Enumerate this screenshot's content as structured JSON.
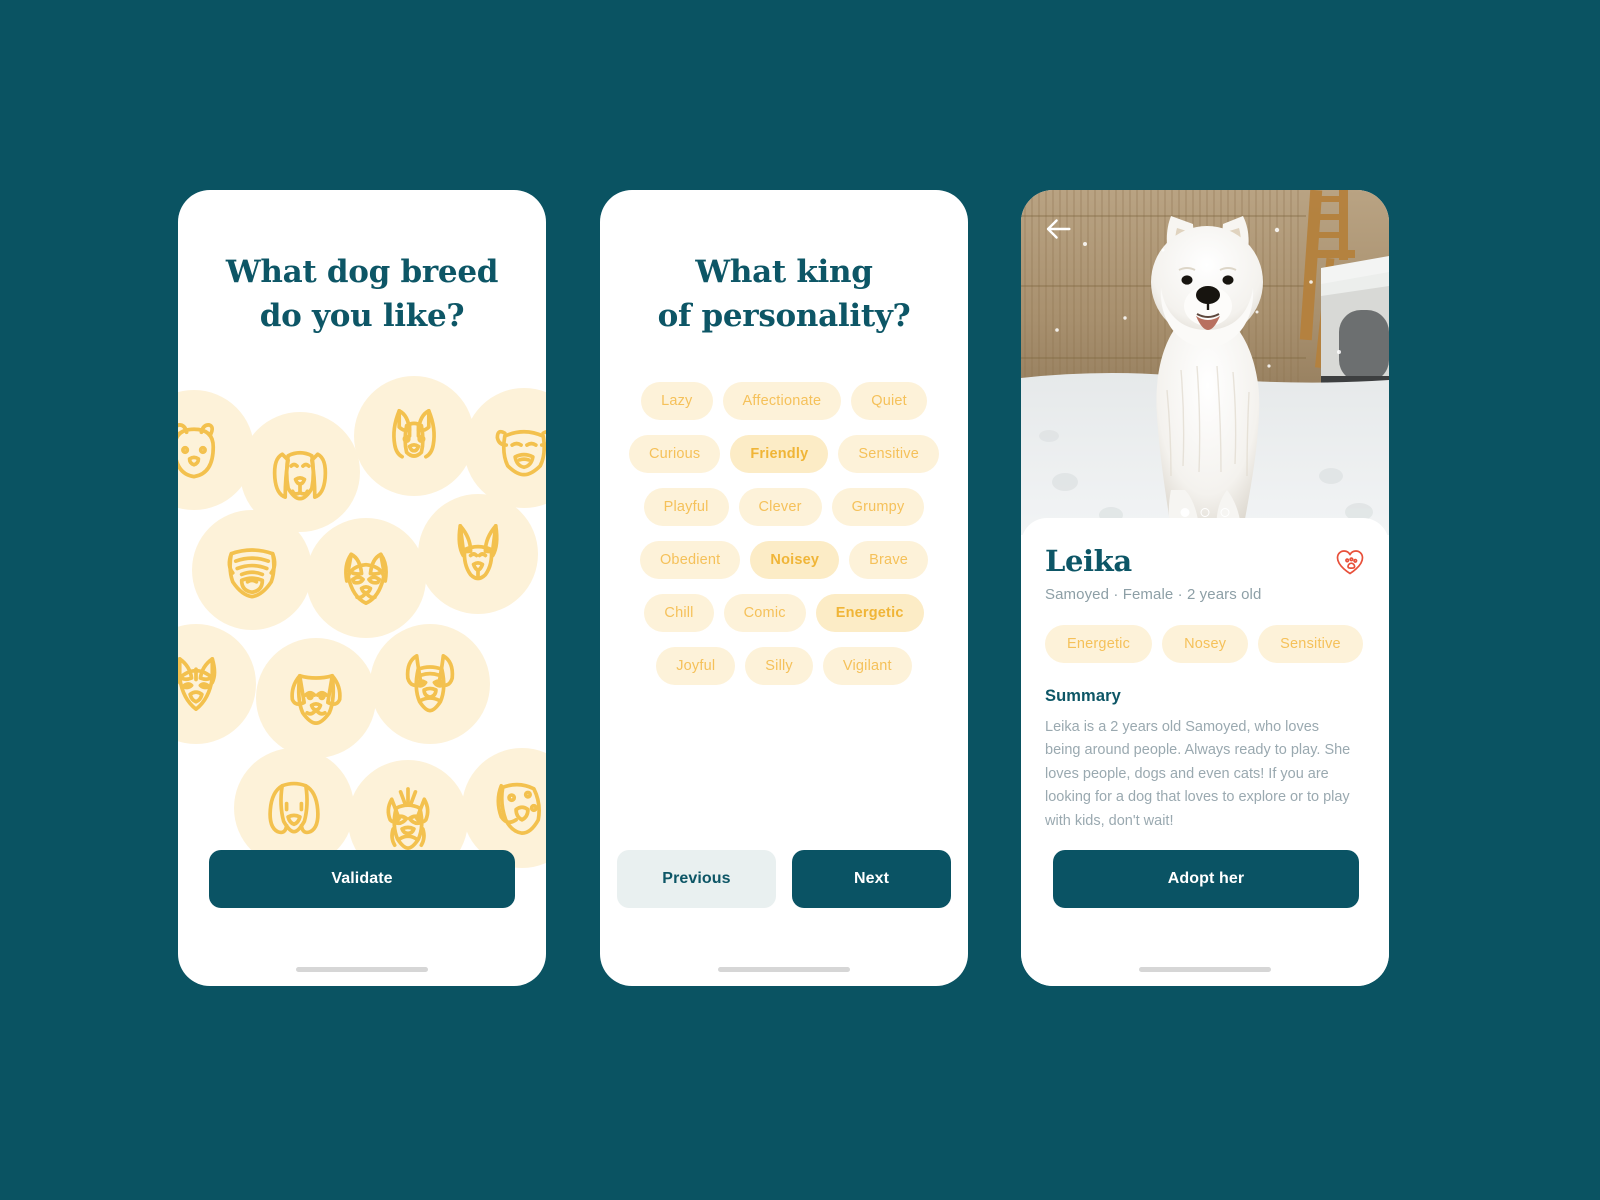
{
  "theme": {
    "background": "#0a5362",
    "card": "#ffffff",
    "accent_teal": "#0d5666",
    "accent_yellow": "#f3c14e",
    "chip_bg": "#fdf2d9",
    "chip_bg_selected": "#fcecc6",
    "muted_text": "#9aa9b0",
    "favorite_red": "#e8503a"
  },
  "screen_breed": {
    "title_line1": "What dog breed",
    "title_line2": "do you like?",
    "validate_label": "Validate",
    "breeds": [
      "chow-chow",
      "saint-bernard",
      "corgi",
      "bulldog",
      "shar-pei",
      "welsh-corgi",
      "german-shepherd",
      "husky",
      "chihuahua",
      "french-bulldog",
      "cocker-spaniel",
      "yorkshire-terrier",
      "dalmatian"
    ]
  },
  "screen_personality": {
    "title_line1": "What king",
    "title_line2": "of personality?",
    "previous_label": "Previous",
    "next_label": "Next",
    "tags": [
      {
        "label": "Lazy",
        "selected": false
      },
      {
        "label": "Affectionate",
        "selected": false
      },
      {
        "label": "Quiet",
        "selected": false
      },
      {
        "label": "Curious",
        "selected": false
      },
      {
        "label": "Friendly",
        "selected": true
      },
      {
        "label": "Sensitive",
        "selected": false
      },
      {
        "label": "Playful",
        "selected": false
      },
      {
        "label": "Clever",
        "selected": false
      },
      {
        "label": "Grumpy",
        "selected": false
      },
      {
        "label": "Obedient",
        "selected": false
      },
      {
        "label": "Noisey",
        "selected": true
      },
      {
        "label": "Brave",
        "selected": false
      },
      {
        "label": "Chill",
        "selected": false
      },
      {
        "label": "Comic",
        "selected": false
      },
      {
        "label": "Energetic",
        "selected": true
      },
      {
        "label": "Joyful",
        "selected": false
      },
      {
        "label": "Silly",
        "selected": false
      },
      {
        "label": "Vigilant",
        "selected": false
      }
    ]
  },
  "screen_detail": {
    "back_icon": "arrow-left-icon",
    "favorite_icon": "heart-paw-icon",
    "carousel": {
      "count": 3,
      "active_index": 0
    },
    "name": "Leika",
    "meta": "Samoyed · Female · 2 years old",
    "breed": "Samoyed",
    "sex": "Female",
    "age": "2 years old",
    "tags": [
      "Energetic",
      "Nosey",
      "Sensitive"
    ],
    "summary_title": "Summary",
    "summary_text": "Leika is a 2 years old Samoyed, who loves being around people. Always ready to play. She loves people, dogs and even cats! If you are looking for a dog that loves to explore or to play with kids, don't wait!",
    "adopt_label": "Adopt her",
    "photo_alt": "white Samoyed dog sitting in snow in front of a bamboo fence"
  }
}
